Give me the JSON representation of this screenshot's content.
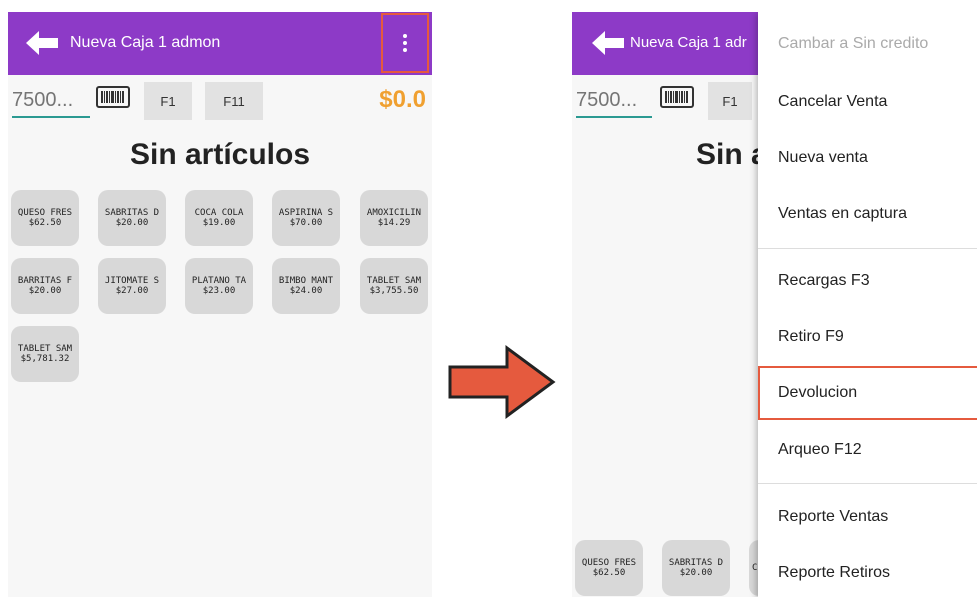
{
  "left": {
    "title": "Nueva Caja 1 admon",
    "qty_placeholder": "7500...",
    "f1": "F1",
    "f11": "F11",
    "total": "$0.0",
    "empty_message": "Sin artículos",
    "products": [
      {
        "name": "QUESO FRES",
        "price": "$62.50"
      },
      {
        "name": "SABRITAS D",
        "price": "$20.00"
      },
      {
        "name": "COCA COLA",
        "price": "$19.00"
      },
      {
        "name": "ASPIRINA S",
        "price": "$70.00"
      },
      {
        "name": "AMOXICILIN",
        "price": "$14.29"
      },
      {
        "name": "BARRITAS F",
        "price": "$20.00"
      },
      {
        "name": "JITOMATE S",
        "price": "$27.00"
      },
      {
        "name": "PLATANO TA",
        "price": "$23.00"
      },
      {
        "name": "BIMBO MANT",
        "price": "$24.00"
      },
      {
        "name": "TABLET SAM",
        "price": "$3,755.50"
      },
      {
        "name": "TABLET SAM",
        "price": "$5,781.32"
      }
    ]
  },
  "right": {
    "title": "Nueva Caja 1 adr",
    "qty_placeholder": "7500...",
    "f1": "F1",
    "empty_message_partial": "Sin a",
    "bottom_products": [
      {
        "name": "QUESO FRES",
        "price": "$62.50"
      },
      {
        "name": "SABRITAS D",
        "price": "$20.00"
      },
      {
        "name": "CC",
        "price": ""
      }
    ],
    "menu": [
      {
        "label": "Cambar a Sin credito",
        "disabled": true
      },
      {
        "label": "Cancelar Venta"
      },
      {
        "label": "Nueva venta"
      },
      {
        "label": "Ventas en captura"
      },
      {
        "label": "Recargas F3"
      },
      {
        "label": "Retiro F9"
      },
      {
        "label": "Devolucion",
        "highlighted": true
      },
      {
        "label": "Arqueo F12"
      },
      {
        "label": "Reporte Ventas"
      },
      {
        "label": "Reporte Retiros"
      }
    ]
  },
  "colors": {
    "appbar": "#8d3ac7",
    "highlight": "#e55a3e",
    "total": "#f0a030",
    "input_underline": "#2b9a92"
  },
  "icons": [
    "back-arrow-icon",
    "more-vert-icon",
    "barcode-icon",
    "right-arrow-icon"
  ]
}
